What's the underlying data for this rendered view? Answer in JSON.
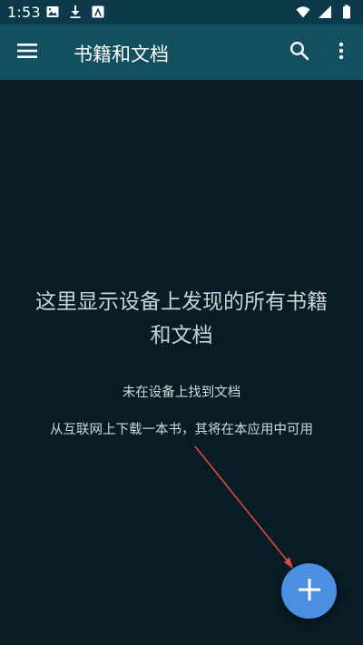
{
  "status_bar": {
    "time": "1:53",
    "icons": [
      "image-icon",
      "download-icon",
      "font-icon",
      "wifi-icon",
      "signal-icon",
      "battery-icon"
    ]
  },
  "app_bar": {
    "title": "书籍和文档",
    "icons": [
      "menu-icon",
      "search-icon",
      "more-vert-icon"
    ]
  },
  "empty_state": {
    "heading": "这里显示设备上发现的所有书籍和文档",
    "subtitle": "未在设备上找到文档",
    "hint": "从互联网上下载一本书，其将在本应用中可用"
  },
  "fab": {
    "icon": "plus-icon",
    "color": "#4a8fe0"
  },
  "colors": {
    "background": "#071c24",
    "status_bar": "#0d3a4a",
    "app_bar": "#12505f",
    "annotation_arrow": "#e0483f"
  }
}
